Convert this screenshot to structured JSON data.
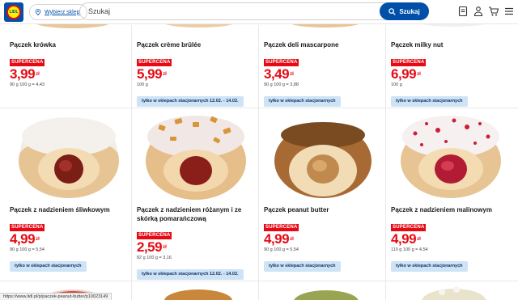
{
  "header": {
    "logo_text": "LIDL",
    "store_label": "Wybierz sklep",
    "search_placeholder": "Szukaj",
    "search_button": "Szukaj",
    "icons": [
      "receipt-icon",
      "account-icon",
      "cart-icon",
      "menu-icon"
    ]
  },
  "products": [
    {
      "name": "Pączek krówka",
      "badge": "SUPERCENA",
      "price": "3,99",
      "currency": "zł",
      "unit": "90 g 100 g = 4,43",
      "availability": ""
    },
    {
      "name": "Pączek crème brûlée",
      "badge": "SUPERCENA",
      "price": "5,99",
      "currency": "zł",
      "unit": "100 g",
      "availability": "tylko w sklepach stacjonarnych 12.02. - 14.02."
    },
    {
      "name": "Pączek deli mascarpone",
      "badge": "SUPERCENA",
      "price": "3,49",
      "currency": "zł",
      "unit": "90 g 100 g = 3,88",
      "availability": "tylko w sklepach stacjonarnych"
    },
    {
      "name": "Pączek milky nut",
      "badge": "SUPERCENA",
      "price": "6,99",
      "currency": "zł",
      "unit": "100 g",
      "availability": "tylko w sklepach stacjonarnych"
    },
    {
      "name": "Pączek z nadzieniem śliwkowym",
      "badge": "SUPERCENA",
      "price": "4,99",
      "currency": "zł",
      "unit": "90 g 100 g = 5,54",
      "availability": "tylko w sklepach stacjonarnych"
    },
    {
      "name": "Pączek z nadzieniem różanym i ze skórką pomarańczową",
      "badge": "SUPERCENA",
      "price": "2,59",
      "currency": "zł",
      "unit": "82 g 100 g = 3,16",
      "availability": "tylko w sklepach stacjonarnych 12.02. - 14.02."
    },
    {
      "name": "Pączek peanut butter",
      "badge": "SUPERCENA",
      "price": "4,99",
      "currency": "zł",
      "unit": "90 g 100 g = 5,54",
      "availability": "tylko w sklepach stacjonarnych"
    },
    {
      "name": "Pączek z nadzieniem malinowym",
      "badge": "SUPERCENA",
      "price": "4,99",
      "currency": "zł",
      "unit": "110 g 100 g = 4,54",
      "availability": "tylko w sklepach stacjonarnych"
    }
  ],
  "status_url": "https://www.lidl.pl/p/paczek-peanut-butter/p10023149",
  "colors": {
    "brand_blue": "#0050aa",
    "price_red": "#e60a14",
    "chip_blue": "#cfe3f7"
  }
}
